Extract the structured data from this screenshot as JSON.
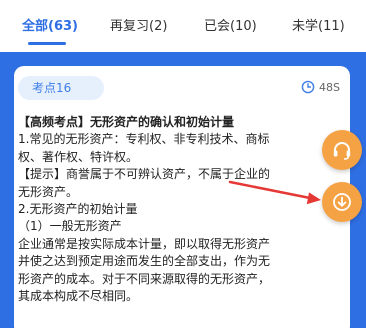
{
  "tabs": [
    {
      "label": "全部(63)",
      "active": true
    },
    {
      "label": "再复习(2)",
      "active": false
    },
    {
      "label": "已会(10)",
      "active": false
    },
    {
      "label": "未学(11)",
      "active": false
    }
  ],
  "card": {
    "badge": "考点16",
    "timer": "48S",
    "lines": [
      "【高频考点】无形资产的确认和初始计量",
      "1.常见的无形资产：专利权、非专利技术、商标",
      "权、著作权、特许权。",
      "【提示】商誉属于不可辨认资产，不属于企业的",
      "无形资产。",
      "2.无形资产的初始计量",
      "（1）一般无形资产",
      "企业通常是按实际成本计量，即以取得无形资产",
      "并使之达到预定用途而发生的全部支出，作为无",
      "形资产的成本。对于不同来源取得的无形资产，",
      "其成本构成不尽相同。"
    ]
  },
  "colors": {
    "accent": "#2f6fe4",
    "float_button": "#f5a244",
    "arrow": "#e53935"
  },
  "icons": {
    "timer": "clock-icon",
    "headset": "headset-icon",
    "download": "download-icon"
  }
}
